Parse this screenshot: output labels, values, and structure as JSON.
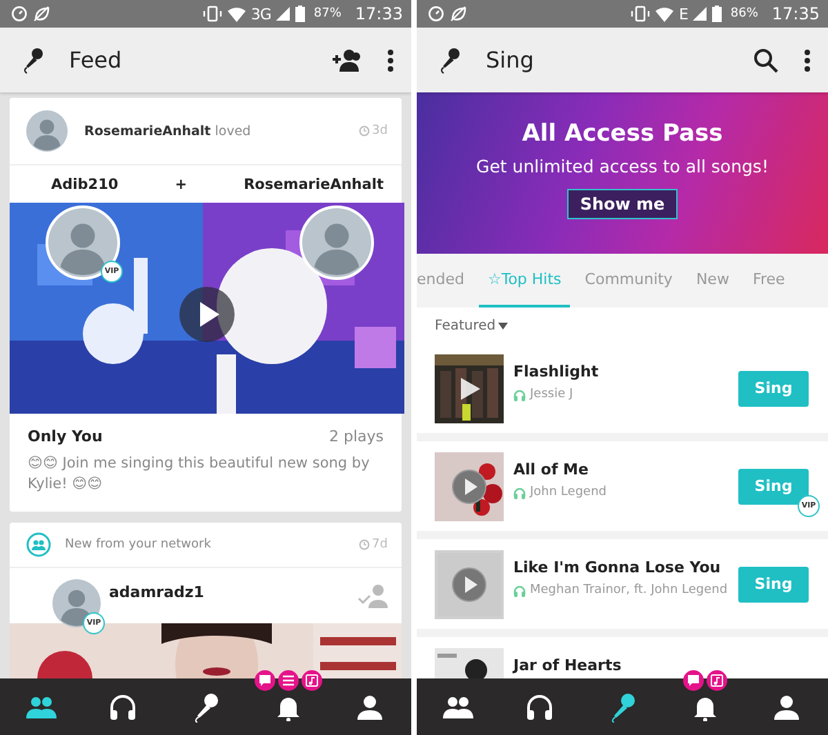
{
  "screens": [
    {
      "status_bar": {
        "network": "3G",
        "battery": "87%",
        "time": "17:33"
      },
      "app_bar": {
        "title": "Feed",
        "actions": [
          {
            "kind": "add-friend"
          },
          {
            "kind": "more"
          }
        ]
      },
      "feed": [
        {
          "kind": "duet",
          "header": "**RosemarieAnhalt** loved",
          "time": "3d",
          "singers": [
            "Adib210",
            "+",
            "RosemarieAnhalt"
          ],
          "vip": "VIP",
          "song": "Only You",
          "plays": "2 plays",
          "caption": "😊😊 Join me singing this beautiful new song by Kylie! 😊😊"
        },
        {
          "kind": "network",
          "header": "New from your network",
          "time": "7d",
          "user": "adamradz1",
          "vip": "VIP"
        }
      ],
      "nav": [
        {
          "kind": "people",
          "selected": true
        },
        {
          "kind": "headphones",
          "selected": false
        },
        {
          "kind": "mic",
          "selected": false
        },
        {
          "kind": "bell",
          "selected": false,
          "badges": [
            {
              "kind": "chat"
            },
            {
              "kind": "list"
            },
            {
              "kind": "music"
            }
          ]
        },
        {
          "kind": "person",
          "selected": false
        }
      ]
    },
    {
      "status_bar": {
        "network": "E",
        "battery": "86%",
        "time": "17:35"
      },
      "app_bar": {
        "title": "Sing",
        "actions": [
          {
            "kind": "search"
          },
          {
            "kind": "more"
          }
        ]
      },
      "banner": {
        "title": "All Access Pass",
        "subtitle": "Get unlimited access to all songs!",
        "button": "Show me"
      },
      "tabs": [
        {
          "label": "ended",
          "selected": false
        },
        {
          "label": "☆Top Hits",
          "selected": true
        },
        {
          "label": "Community",
          "selected": false
        },
        {
          "label": "New",
          "selected": false
        },
        {
          "label": "Free",
          "selected": false
        }
      ],
      "sort": "Featured",
      "songs": [
        {
          "title": "Flashlight",
          "artist": "Jessie J",
          "button": "Sing",
          "play_icon": true
        },
        {
          "title": "All of Me",
          "artist": "John Legend",
          "button": "Sing",
          "vip": "VIP",
          "play_icon": true
        },
        {
          "title": "Like I'm Gonna Lose You",
          "artist": "Meghan Trainor, ft. John Legend",
          "button": "Sing",
          "play_icon": true
        },
        {
          "title": "Jar of Hearts",
          "play_icon": false
        }
      ],
      "nav": [
        {
          "kind": "people",
          "selected": false
        },
        {
          "kind": "headphones",
          "selected": false
        },
        {
          "kind": "mic",
          "selected": true
        },
        {
          "kind": "bell",
          "selected": false,
          "badges": [
            {
              "kind": "chat"
            },
            {
              "kind": "music"
            }
          ]
        },
        {
          "kind": "person",
          "selected": false
        }
      ]
    }
  ]
}
